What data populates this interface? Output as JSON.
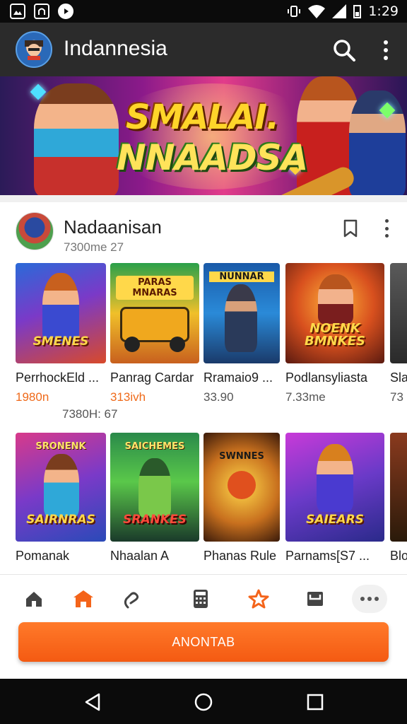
{
  "status_bar": {
    "time": "1:29",
    "icons": [
      "image-icon",
      "bag-icon",
      "circle-play-icon",
      "vibrate-icon",
      "wifi-icon",
      "signal-icon",
      "battery-icon"
    ]
  },
  "app_bar": {
    "title": "Indannesia",
    "icons": [
      "app-logo",
      "search-icon",
      "more-vert-icon"
    ]
  },
  "banner": {
    "line1": "SMALAI.",
    "line2": "NNAADSA"
  },
  "section": {
    "title": "Nadaanisan",
    "subtitle": "7300me 27",
    "icons": [
      "bookmark-icon",
      "more-vert-icon"
    ]
  },
  "row1": [
    {
      "name": "PerrhockEld ...",
      "price": "1980n",
      "price_color": "#ef6a1a",
      "art_top": "",
      "art_bottom": "SMENES"
    },
    {
      "name": "Panrag Cardar",
      "price": "313ivh",
      "price_color": "#ef6a1a",
      "art_top": "PARAS MNARAS",
      "art_bottom": ""
    },
    {
      "name": "Rramaio9 ...",
      "price": "33.90",
      "price_color": "#555555",
      "art_top": "NUNNAR",
      "art_bottom": ""
    },
    {
      "name": "Podlansyliasta",
      "price": "7.33me",
      "price_color": "#555555",
      "art_top": "",
      "art_bottom": "NOENK BMNKES"
    },
    {
      "name": "Sla",
      "price": "73",
      "price_color": "#555555",
      "art_top": "",
      "art_bottom": ""
    }
  ],
  "row1_note": "7380H: 67",
  "row2": [
    {
      "name": "Pomanak",
      "art_top": "SRONENK",
      "art_bottom": "SAIRNRAS"
    },
    {
      "name": "Nhaalan A",
      "art_top": "SAICHEMES",
      "art_bottom": "SRANKES"
    },
    {
      "name": "Phanas Rule",
      "art_top": "SWNNES",
      "art_bottom": ""
    },
    {
      "name": "Parnams[S7 ...",
      "art_top": "",
      "art_bottom": "SAIEARS"
    },
    {
      "name": "Blo",
      "art_top": "",
      "art_bottom": ""
    }
  ],
  "bottom_nav": {
    "items": [
      "home-icon",
      "store-icon",
      "heart-hand-icon",
      "calculator-icon",
      "star-icon",
      "inbox-icon",
      "more-horiz-icon"
    ],
    "accent": "#f4641a"
  },
  "cta": {
    "label": "ANONTAB"
  },
  "system_nav": {
    "icons": [
      "back-icon",
      "home-circle-icon",
      "recents-icon"
    ]
  }
}
